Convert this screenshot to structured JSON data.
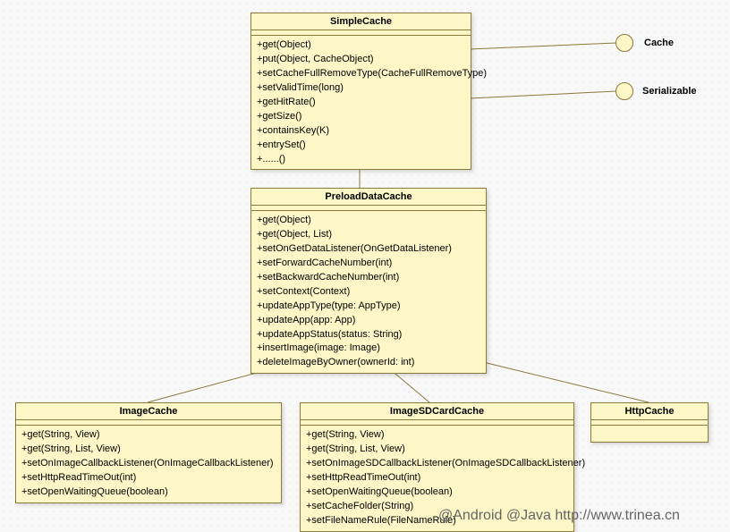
{
  "classes": {
    "simpleCache": {
      "name": "SimpleCache",
      "methods": [
        "+get(Object)",
        "+put(Object, CacheObject)",
        "+setCacheFullRemoveType(CacheFullRemoveType)",
        "+setValidTime(long)",
        "+getHitRate()",
        "+getSize()",
        "+containsKey(K)",
        "+entrySet()",
        "+......()"
      ]
    },
    "preloadDataCache": {
      "name": "PreloadDataCache",
      "methods": [
        "+get(Object)",
        "+get(Object, List)",
        "+setOnGetDataListener(OnGetDataListener)",
        "+setForwardCacheNumber(int)",
        "+setBackwardCacheNumber(int)",
        "+setContext(Context)",
        "+updateAppType(type: AppType)",
        "+updateApp(app: App)",
        "+updateAppStatus(status: String)",
        "+insertImage(image: Image)",
        "+deleteImageByOwner(ownerId: int)"
      ]
    },
    "imageCache": {
      "name": "ImageCache",
      "methods": [
        "+get(String, View)",
        "+get(String, List, View)",
        "+setOnImageCallbackListener(OnImageCallbackListener)",
        "+setHttpReadTimeOut(int)",
        "+setOpenWaitingQueue(boolean)"
      ]
    },
    "imageSDCardCache": {
      "name": "ImageSDCardCache",
      "methods": [
        "+get(String, View)",
        "+get(String, List, View)",
        "+setOnImageSDCallbackListener(OnImageSDCallbackListener)",
        "+setHttpReadTimeOut(int)",
        "+setOpenWaitingQueue(boolean)",
        "+setCacheFolder(String)",
        "+setFileNameRule(FileNameRule)"
      ]
    },
    "httpCache": {
      "name": "HttpCache",
      "methods": []
    }
  },
  "interfaces": {
    "cache": "Cache",
    "serializable": "Serializable"
  },
  "watermark": "@Android @Java http://www.trinea.cn"
}
